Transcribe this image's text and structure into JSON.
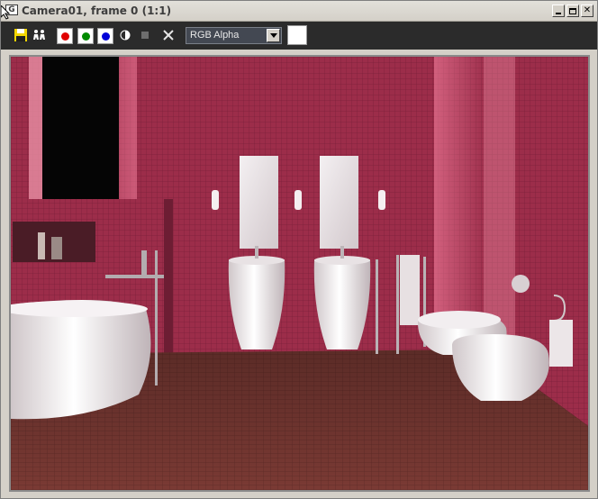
{
  "window": {
    "title": "Camera01, frame 0 (1:1)",
    "icon": "frame-window-icon",
    "controls": {
      "minimize": "minimize-icon",
      "maximize": "maximize-icon",
      "close_label": "✕"
    }
  },
  "toolbar": {
    "save_icon": "save-icon",
    "clone_icon": "clone-window-icon",
    "channels": [
      {
        "name": "red-channel-icon",
        "color": "#e00000"
      },
      {
        "name": "green-channel-icon",
        "color": "#008a00"
      },
      {
        "name": "blue-channel-icon",
        "color": "#0000d8"
      }
    ],
    "mono_icon": "monochrome-icon",
    "stop_icon": "stop-icon",
    "clear_icon": "clear-icon",
    "channel_display": {
      "value": "RGB Alpha"
    },
    "background_swatch": "#ffffff"
  },
  "render": {
    "description_icon": "rendered-bathroom-image"
  }
}
